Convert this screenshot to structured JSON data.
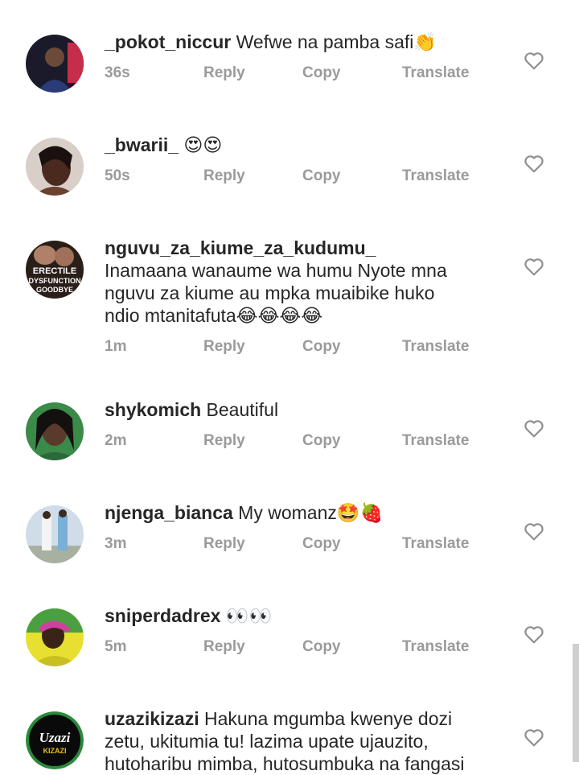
{
  "comments": [
    {
      "username": "_pokot_niccur",
      "text": " Wefwe na pamba safi👏",
      "time": "36s",
      "reply": "Reply",
      "copy": "Copy",
      "translate": "Translate"
    },
    {
      "username": "_bwarii_",
      "text": " 😍😍",
      "time": "50s",
      "reply": "Reply",
      "copy": "Copy",
      "translate": "Translate"
    },
    {
      "username": "nguvu_za_kiume_za_kudumu_",
      "text": " Inamaana wanaume wa humu Nyote mna nguvu za kiume au mpka muaibike huko ndio mtanitafuta😂😂😂😂",
      "time": "1m",
      "reply": "Reply",
      "copy": "Copy",
      "translate": "Translate",
      "avatar_text": [
        "ERECTILE",
        "DYSFUNCTION",
        "GOODBYE"
      ]
    },
    {
      "username": "shykomich",
      "text": " Beautiful",
      "time": "2m",
      "reply": "Reply",
      "copy": "Copy",
      "translate": "Translate"
    },
    {
      "username": "njenga_bianca",
      "text": " My womanz🤩🍓",
      "time": "3m",
      "reply": "Reply",
      "copy": "Copy",
      "translate": "Translate"
    },
    {
      "username": "sniperdadrex",
      "text": " 👀👀",
      "time": "5m",
      "reply": "Reply",
      "copy": "Copy",
      "translate": "Translate"
    },
    {
      "username": "uzazikizazi",
      "text": " Hakuna mgumba kwenye dozi zetu, ukitumia tu! lazima upate ujauzito, hutoharibu mimba, hutosumbuka na fangasi",
      "time": "",
      "reply": "",
      "copy": "",
      "translate": "",
      "avatar_text": [
        "Uzazi",
        "KIZAZI"
      ]
    }
  ],
  "icons": {
    "like": "heart-outline-icon"
  },
  "colors": {
    "text": "#262626",
    "meta": "#9a9a9a",
    "heart": "#8e8e8e"
  }
}
